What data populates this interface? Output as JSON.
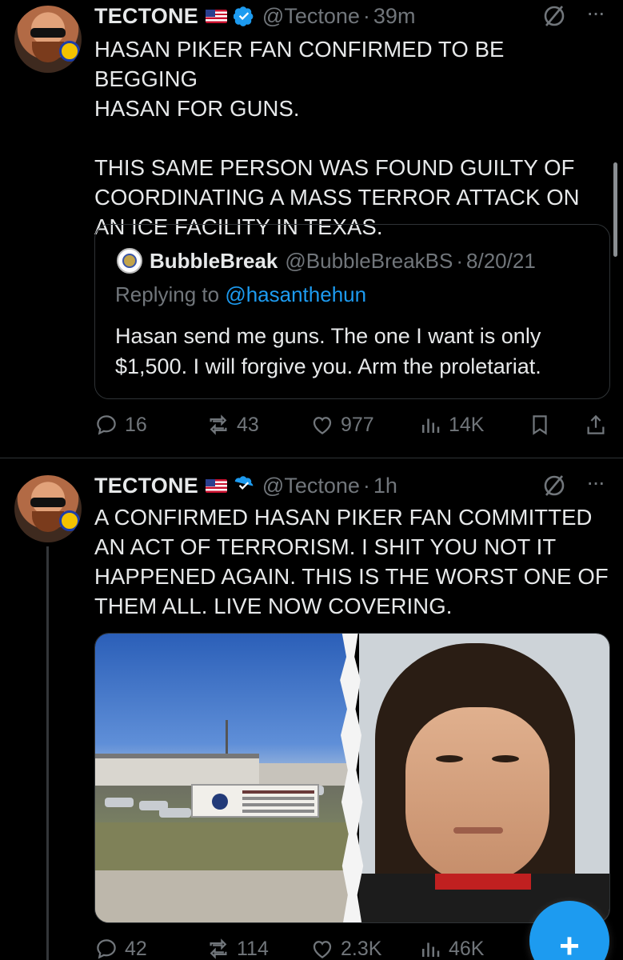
{
  "tweets": [
    {
      "author": {
        "name": "TECTONE",
        "handle": "@Tectone",
        "time": "39m",
        "flag_icon": "us-flag-icon",
        "verified_icon": "verified-badge-icon",
        "verified_color": "#1d9bf0"
      },
      "text": "HASAN PIKER FAN CONFIRMED TO BE BEGGING\nHASAN FOR GUNS.\n\nTHIS SAME PERSON WAS FOUND GUILTY OF\nCOORDINATING A MASS TERROR ATTACK ON\nAN ICE FACILITY IN TEXAS.",
      "quote": {
        "name": "BubbleBreak",
        "handle": "@BubbleBreakBS",
        "date": "8/20/21",
        "replying_prefix": "Replying to ",
        "replying_to": "@hasanthehun",
        "text": "Hasan send me guns. The one I want is only $1,500. I will forgive you. Arm the proletariat."
      },
      "actions": {
        "replies": "16",
        "reposts": "43",
        "likes": "977",
        "views": "14K"
      }
    },
    {
      "author": {
        "name": "TECTONE",
        "handle": "@Tectone",
        "time": "1h",
        "flag_icon": "us-flag-icon",
        "verified_icon": "verified-badge-icon",
        "verified_color": "#1d9bf0"
      },
      "text": "A CONFIRMED HASAN PIKER FAN COMMITTED\nAN ACT OF TERRORISM. I SHIT YOU NOT IT\nHAPPENED AGAIN. THIS IS THE WORST ONE OF\nTHEM ALL. LIVE NOW COVERING.",
      "media": {
        "description_left": "detention-facility-photo",
        "description_right": "mugshot-photo"
      },
      "actions": {
        "replies": "42",
        "reposts": "114",
        "likes": "2.3K",
        "views": "46K"
      }
    }
  ],
  "dot_separator": "·",
  "more_icon": "more-options-icon",
  "grok_icon": "grok-icon",
  "fab": {
    "label": "+",
    "color": "#1d9bf0"
  },
  "colors": {
    "background": "#000000",
    "text": "#e7e9ea",
    "secondary": "#71767b",
    "accent": "#1d9bf0",
    "border": "#2f3336"
  }
}
